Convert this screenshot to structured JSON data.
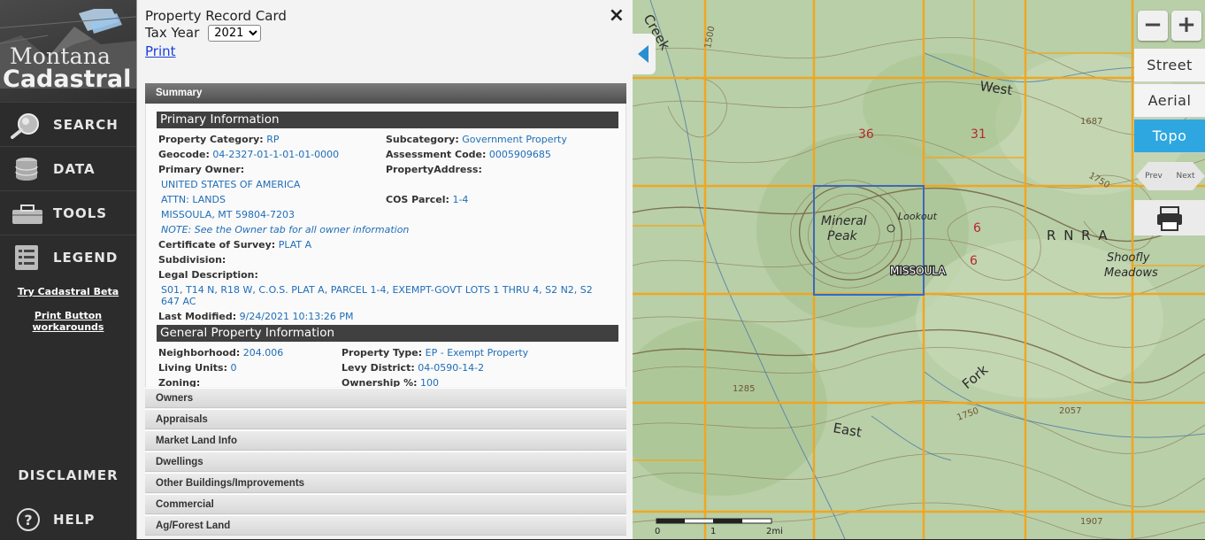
{
  "nav": {
    "logo_line1": "Montana",
    "logo_line2": "Cadastral",
    "items": [
      {
        "label": "SEARCH",
        "icon": "search-icon"
      },
      {
        "label": "DATA",
        "icon": "database-icon"
      },
      {
        "label": "TOOLS",
        "icon": "toolbox-icon"
      },
      {
        "label": "LEGEND",
        "icon": "legend-icon"
      }
    ],
    "beta_link": "Try Cadastral Beta",
    "print_link": "Print Button workarounds",
    "disclaimer": "DISCLAIMER",
    "help": "HELP"
  },
  "panel": {
    "title": "Property Record Card",
    "tax_year_label": "Tax Year",
    "tax_year_value": "2021",
    "print_label": "Print",
    "close_glyph": "×",
    "summary_label": "Summary",
    "primary_heading": "Primary Information",
    "primary": {
      "property_category_label": "Property Category:",
      "property_category_value": "RP",
      "subcategory_label": "Subcategory:",
      "subcategory_value": "Government Property",
      "geocode_label": "Geocode:",
      "geocode_value": "04-2327-01-1-01-01-0000",
      "assessment_code_label": "Assessment Code:",
      "assessment_code_value": "0005909685",
      "primary_owner_label": "Primary Owner:",
      "property_address_label": "PropertyAddress:",
      "owner_lines": [
        "UNITED STATES OF AMERICA",
        "ATTN: LANDS",
        "MISSOULA, MT 59804-7203"
      ],
      "cos_parcel_label": "COS Parcel:",
      "cos_parcel_value": "1-4",
      "owner_note": "NOTE: See the Owner tab for all owner information",
      "cert_survey_label": "Certificate of Survey:",
      "cert_survey_value": "PLAT A",
      "subdivision_label": "Subdivision:",
      "legal_desc_label": "Legal Description:",
      "legal_desc_line1": "S01, T14 N, R18 W, C.O.S. PLAT A, PARCEL 1-4, EXEMPT-GOVT LOTS 1 THRU 4, S2 N2, S2",
      "legal_desc_line2": "647 AC",
      "last_modified_label": "Last Modified:",
      "last_modified_value": "9/24/2021 10:13:26 PM"
    },
    "general_heading": "General Property Information",
    "general": {
      "neighborhood_label": "Neighborhood:",
      "neighborhood_value": "204.006",
      "property_type_label": "Property Type:",
      "property_type_value": "EP - Exempt Property",
      "living_units_label": "Living Units:",
      "living_units_value": "0",
      "levy_district_label": "Levy District:",
      "levy_district_value": "04-0590-14-2",
      "zoning_label": "Zoning:",
      "ownership_label": "Ownership %:",
      "ownership_value": "100"
    },
    "sections": [
      "Owners",
      "Appraisals",
      "Market Land Info",
      "Dwellings",
      "Other Buildings/Improvements",
      "Commercial",
      "Ag/Forest Land"
    ]
  },
  "map": {
    "zoom_out": "−",
    "zoom_in": "+",
    "basemaps": [
      "Street",
      "Aerial",
      "Topo"
    ],
    "active_basemap": "Topo",
    "prev_label": "Prev",
    "next_label": "Next",
    "parcel_label": "MISSOULA",
    "section_numbers": [
      "36",
      "31",
      "6",
      "6"
    ],
    "place_labels": [
      "Mineral",
      "Peak",
      "Lookout",
      "R N R A",
      "Shoofly",
      "Meadows",
      "West",
      "East",
      "Fork",
      "Creek"
    ],
    "elevation_labels": [
      "1500",
      "1687",
      "1750",
      "1285",
      "1750",
      "2057",
      "1907"
    ],
    "scale_start": "0",
    "scale_mid": "1",
    "scale_end": "2mi",
    "colors": {
      "section_line": "#f2a51c",
      "parcel_outline": "#2d6cd2",
      "accent": "#2ea7e0"
    }
  }
}
